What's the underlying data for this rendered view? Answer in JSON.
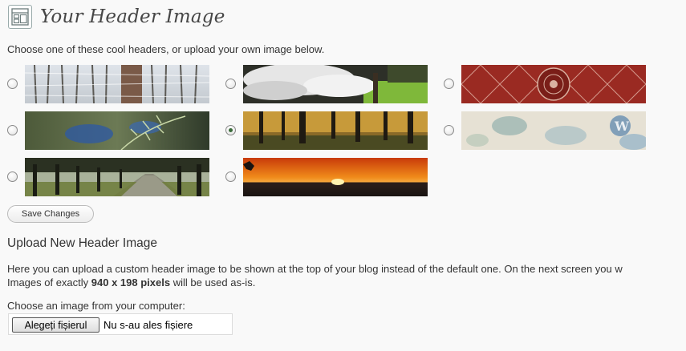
{
  "page": {
    "title": "Your Header Image",
    "title_icon": "appearance-icon",
    "intro": "Choose one of these cool headers, or upload your own image below."
  },
  "headers": [
    {
      "name": "winter-forest",
      "checked": false
    },
    {
      "name": "blossom-tree",
      "checked": false
    },
    {
      "name": "red-pattern",
      "checked": false
    },
    {
      "name": "fern-leaves",
      "checked": false
    },
    {
      "name": "autumn-forest",
      "checked": true
    },
    {
      "name": "watercolor-wordpress",
      "checked": false
    },
    {
      "name": "tree-avenue",
      "checked": false
    },
    {
      "name": "sunset",
      "checked": false
    }
  ],
  "save_button": "Save Changes",
  "upload": {
    "heading": "Upload New Header Image",
    "line1": "Here you can upload a custom header image to be shown at the top of your blog instead of the default one. On the next screen you w",
    "line2_prefix": "Images of exactly ",
    "line2_bold": "940 x 198 pixels",
    "line2_suffix": " will be used as-is.",
    "choose_label": "Choose an image from your computer:",
    "file_button": "Alegeți fișierul",
    "file_status": "Nu s-au ales fișiere"
  },
  "colors": {
    "background": "#f9f9f9",
    "text": "#333333"
  }
}
